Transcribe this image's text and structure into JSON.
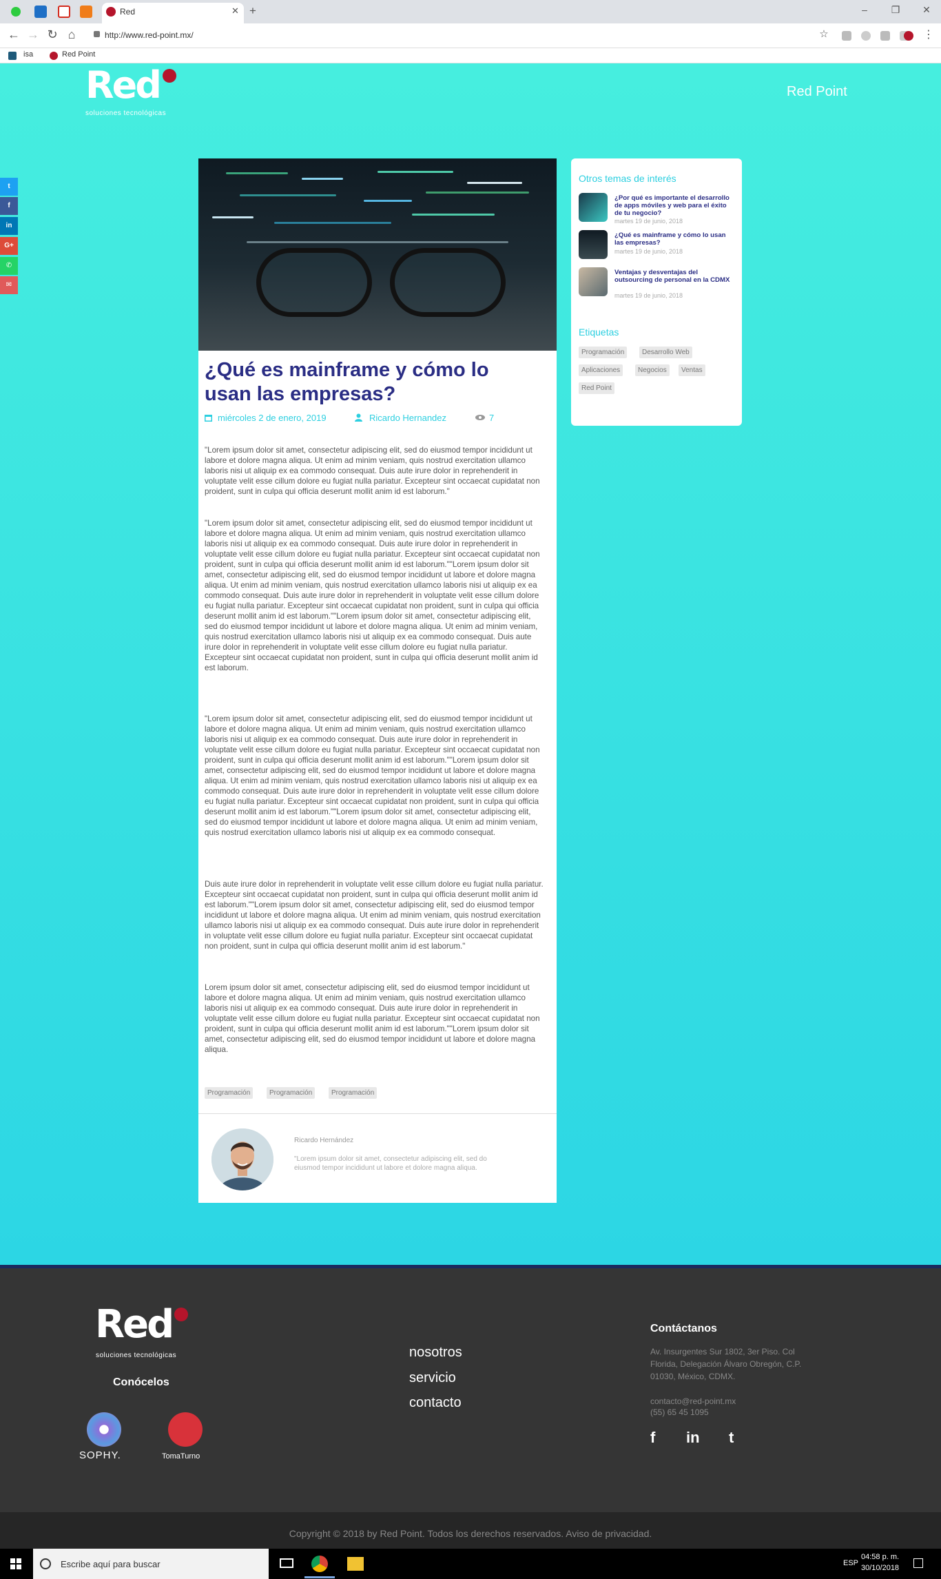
{
  "browser": {
    "tab_title": "Red",
    "url": "http://www.red-point.mx/",
    "bookmarks": [
      "isa",
      "Red Point"
    ]
  },
  "header": {
    "logo_text": "Red",
    "logo_sub": "soluciones tecnológicas",
    "brand_link": "Red Point"
  },
  "share": [
    "twitter",
    "facebook",
    "linkedin",
    "google-plus",
    "whatsapp",
    "email"
  ],
  "article": {
    "title": "¿Qué es mainframe y cómo lo usan las empresas?",
    "date": "miércoles 2 de enero, 2019",
    "author": "Ricardo Hernandez",
    "views": "7",
    "paragraphs": [
      "\"Lorem ipsum dolor sit amet, consectetur adipiscing elit, sed do eiusmod tempor incididunt ut labore et dolore magna aliqua. Ut enim ad minim veniam, quis nostrud exercitation ullamco laboris nisi ut aliquip ex ea commodo consequat. Duis aute irure dolor in reprehenderit in voluptate velit esse cillum dolore eu fugiat nulla pariatur. Excepteur sint occaecat cupidatat non proident, sunt in culpa qui officia deserunt mollit anim id est laborum.\"",
      "\"Lorem ipsum dolor sit amet, consectetur adipiscing elit, sed do eiusmod tempor incididunt ut labore et dolore magna aliqua. Ut enim ad minim veniam, quis nostrud exercitation ullamco laboris nisi ut aliquip ex ea commodo consequat. Duis aute irure dolor in reprehenderit in voluptate velit esse cillum dolore eu fugiat nulla pariatur. Excepteur sint occaecat cupidatat non proident, sunt in culpa qui officia deserunt mollit anim id est laborum.\"\"Lorem ipsum dolor sit amet, consectetur adipiscing elit, sed do eiusmod tempor incididunt ut labore et dolore magna aliqua. Ut enim ad minim veniam, quis nostrud exercitation ullamco laboris nisi ut aliquip ex ea commodo consequat. Duis aute irure dolor in reprehenderit in voluptate velit esse cillum dolore eu fugiat nulla pariatur. Excepteur sint occaecat cupidatat non proident, sunt in culpa qui officia deserunt mollit anim id est laborum.\"\"Lorem ipsum dolor sit amet, consectetur adipiscing elit, sed do eiusmod tempor incididunt ut labore et dolore magna aliqua. Ut enim ad minim veniam, quis nostrud exercitation ullamco laboris nisi ut aliquip ex ea commodo consequat. Duis aute irure dolor in reprehenderit in voluptate velit esse cillum dolore eu fugiat nulla pariatur. Excepteur sint occaecat cupidatat non proident, sunt in culpa qui officia deserunt mollit anim id est laborum.",
      "\"Lorem ipsum dolor sit amet, consectetur adipiscing elit, sed do eiusmod tempor incididunt ut labore et dolore magna aliqua. Ut enim ad minim veniam, quis nostrud exercitation ullamco laboris nisi ut aliquip ex ea commodo consequat. Duis aute irure dolor in reprehenderit in voluptate velit esse cillum dolore eu fugiat nulla pariatur. Excepteur sint occaecat cupidatat non proident, sunt in culpa qui officia deserunt mollit anim id est laborum.\"\"Lorem ipsum dolor sit amet, consectetur adipiscing elit, sed do eiusmod tempor incididunt ut labore et dolore magna aliqua. Ut enim ad minim veniam, quis nostrud exercitation ullamco laboris nisi ut aliquip ex ea commodo consequat. Duis aute irure dolor in reprehenderit in voluptate velit esse cillum dolore eu fugiat nulla pariatur. Excepteur sint occaecat cupidatat non proident, sunt in culpa qui officia deserunt mollit anim id est laborum.\"\"Lorem ipsum dolor sit amet, consectetur adipiscing elit, sed do eiusmod tempor incididunt ut labore et dolore magna aliqua. Ut enim ad minim veniam, quis nostrud exercitation ullamco laboris nisi ut aliquip ex ea commodo consequat.",
      "Duis aute irure dolor in reprehenderit in voluptate velit esse cillum dolore eu fugiat nulla pariatur. Excepteur sint occaecat cupidatat non proident, sunt in culpa qui officia deserunt mollit anim id est laborum.\"\"Lorem ipsum dolor sit amet, consectetur adipiscing elit, sed do eiusmod tempor incididunt ut labore et dolore magna aliqua. Ut enim ad minim veniam, quis nostrud exercitation ullamco laboris nisi ut aliquip ex ea commodo consequat. Duis aute irure dolor in reprehenderit in voluptate velit esse cillum dolore eu fugiat nulla pariatur. Excepteur sint occaecat cupidatat non proident, sunt in culpa qui officia deserunt mollit anim id est laborum.\"",
      "Lorem ipsum dolor sit amet, consectetur adipiscing elit, sed do eiusmod tempor incididunt ut labore et dolore magna aliqua. Ut enim ad minim veniam, quis nostrud exercitation ullamco laboris nisi ut aliquip ex ea commodo consequat. Duis aute irure dolor in reprehenderit in voluptate velit esse cillum dolore eu fugiat nulla pariatur. Excepteur sint occaecat cupidatat non proident, sunt in culpa qui officia deserunt mollit anim id est laborum.\"\"Lorem ipsum dolor sit amet, consectetur adipiscing elit, sed do eiusmod tempor incididunt ut labore et dolore magna aliqua."
    ],
    "tags": [
      "Programación",
      "Programación",
      "Programación"
    ],
    "author_box": {
      "name": "Ricardo Hernández",
      "bio": "\"Lorem ipsum dolor sit amet, consectetur adipiscing elit, sed do eiusmod tempor incididunt ut labore et dolore magna aliqua."
    }
  },
  "sidebar": {
    "related_title": "Otros temas de interés",
    "related": [
      {
        "title": "¿Por qué es importante el desarrollo de apps móviles y web para el éxito de tu negocio?",
        "date": "martes 19 de junio, 2018"
      },
      {
        "title": "¿Qué es mainframe y cómo lo usan las empresas?",
        "date": "martes 19 de junio, 2018"
      },
      {
        "title": "Ventajas y desventajas del outsourcing de personal en la CDMX",
        "date": "martes 19 de junio, 2018"
      }
    ],
    "tags_title": "Etiquetas",
    "tags": [
      "Programación",
      "Desarrollo Web",
      "Aplicaciones",
      "Negocios",
      "Ventas",
      "Red Point"
    ]
  },
  "footer": {
    "logo_text": "Red",
    "logo_sub": "soluciones tecnológicas",
    "conocelos": "Conócelos",
    "partners": [
      "SOPHY.",
      "TomaTurno"
    ],
    "nav": [
      "nosotros",
      "servicio",
      "contacto"
    ],
    "contact_title": "Contáctanos",
    "address": "Av. Insurgentes Sur 1802, 3er Piso. Col Florida, Delegación Álvaro Obregón, C.P. 01030, México, CDMX.",
    "email": "contacto@red-point.mx",
    "phone": "(55) 65 45 1095",
    "social": [
      "f",
      "in",
      "t"
    ],
    "copyright": "Copyright © 2018 by Red Point. Todos los derechos reservados. Aviso de privacidad."
  },
  "taskbar": {
    "search_placeholder": "Escribe aquí para buscar",
    "lang": "ESP",
    "time": "04:58 p. m.",
    "date": "30/10/2018"
  }
}
